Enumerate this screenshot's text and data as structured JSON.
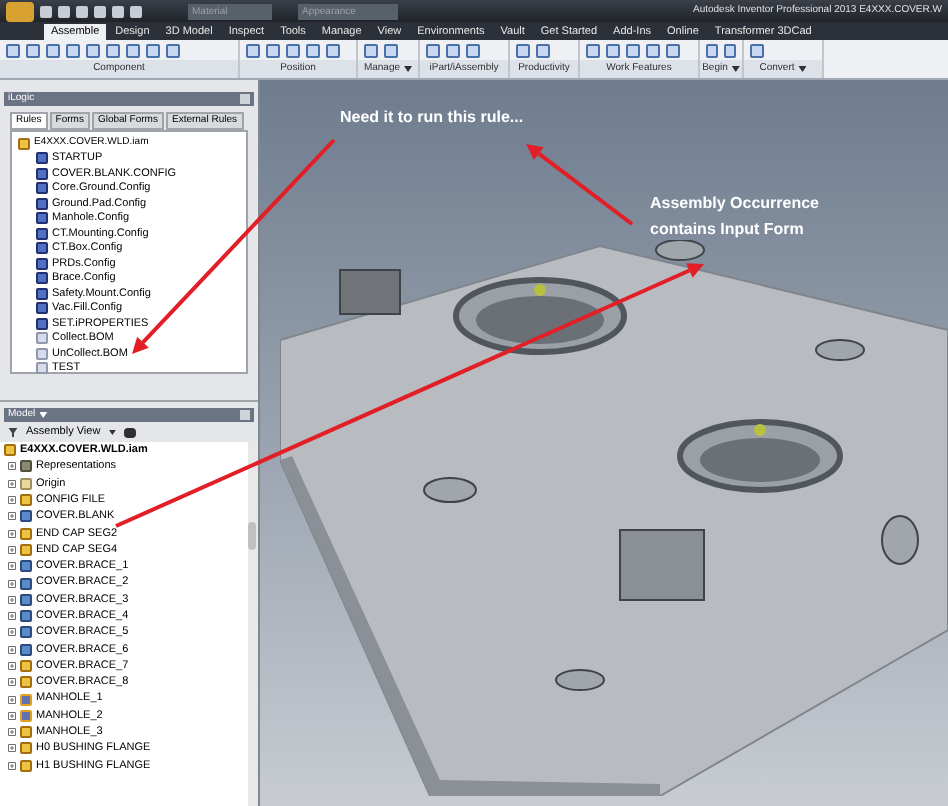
{
  "window": {
    "title": "Autodesk Inventor Professional 2013   E4XXX.COVER.W"
  },
  "quick_access": {
    "material": "Material",
    "appearance": "Appearance"
  },
  "ribbon_tabs": [
    {
      "label": "Assemble",
      "selected": true
    },
    {
      "label": "Design",
      "selected": false
    },
    {
      "label": "3D Model",
      "selected": false
    },
    {
      "label": "Inspect",
      "selected": false
    },
    {
      "label": "Tools",
      "selected": false
    },
    {
      "label": "Manage",
      "selected": false
    },
    {
      "label": "View",
      "selected": false
    },
    {
      "label": "Environments",
      "selected": false
    },
    {
      "label": "Vault",
      "selected": false
    },
    {
      "label": "Get Started",
      "selected": false
    },
    {
      "label": "Add-Ins",
      "selected": false
    },
    {
      "label": "Online",
      "selected": false
    },
    {
      "label": "Transformer 3DCad",
      "selected": false
    }
  ],
  "ribbon_panels": [
    {
      "label": "Component",
      "dropdown": false
    },
    {
      "label": "Position",
      "dropdown": false
    },
    {
      "label": "Manage",
      "dropdown": true
    },
    {
      "label": "iPart/iAssembly",
      "dropdown": false
    },
    {
      "label": "Productivity",
      "dropdown": false
    },
    {
      "label": "Work Features",
      "dropdown": false
    },
    {
      "label": "Begin",
      "dropdown": true
    },
    {
      "label": "Convert",
      "dropdown": true
    }
  ],
  "ilogic": {
    "title": "iLogic",
    "tabs": [
      {
        "label": "Rules",
        "selected": true
      },
      {
        "label": "Forms",
        "selected": false
      },
      {
        "label": "Global Forms",
        "selected": false
      },
      {
        "label": "External Rules",
        "selected": false
      }
    ],
    "root": "E4XXX.COVER.WLD.iam",
    "rules": [
      {
        "name": "STARTUP",
        "suppressed": false
      },
      {
        "name": "COVER.BLANK.CONFIG",
        "suppressed": false
      },
      {
        "name": "Core.Ground.Config",
        "suppressed": false
      },
      {
        "name": "Ground.Pad.Config",
        "suppressed": false
      },
      {
        "name": "Manhole.Config",
        "suppressed": false
      },
      {
        "name": "CT.Mounting.Config",
        "suppressed": false
      },
      {
        "name": "CT.Box.Config",
        "suppressed": false
      },
      {
        "name": "PRDs.Config",
        "suppressed": false
      },
      {
        "name": "Brace.Config",
        "suppressed": false
      },
      {
        "name": "Safety.Mount.Config",
        "suppressed": false
      },
      {
        "name": "Vac.Fill.Config",
        "suppressed": false
      },
      {
        "name": "SET.iPROPERTIES",
        "suppressed": false
      },
      {
        "name": "Collect.BOM",
        "suppressed": true
      },
      {
        "name": "UnCollect.BOM",
        "suppressed": true
      },
      {
        "name": "TEST",
        "suppressed": true
      }
    ]
  },
  "model": {
    "title": "Model",
    "view": "Assembly View",
    "root": "E4XXX.COVER.WLD.iam",
    "items": [
      {
        "name": "Representations",
        "kind": "representations"
      },
      {
        "name": "Origin",
        "kind": "origin"
      },
      {
        "name": "CONFIG FILE",
        "kind": "assembly"
      },
      {
        "name": "COVER.BLANK",
        "kind": "part"
      },
      {
        "name": "END CAP SEG2",
        "kind": "assembly"
      },
      {
        "name": "END CAP SEG4",
        "kind": "assembly"
      },
      {
        "name": "COVER.BRACE_1",
        "kind": "part"
      },
      {
        "name": "COVER.BRACE_2",
        "kind": "part"
      },
      {
        "name": "COVER.BRACE_3",
        "kind": "part"
      },
      {
        "name": "COVER.BRACE_4",
        "kind": "part"
      },
      {
        "name": "COVER.BRACE_5",
        "kind": "part"
      },
      {
        "name": "COVER.BRACE_6",
        "kind": "part"
      },
      {
        "name": "COVER.BRACE_7",
        "kind": "assembly"
      },
      {
        "name": "COVER.BRACE_8",
        "kind": "assembly"
      },
      {
        "name": "MANHOLE_1",
        "kind": "weldment"
      },
      {
        "name": "MANHOLE_2",
        "kind": "weldment"
      },
      {
        "name": "MANHOLE_3",
        "kind": "assembly"
      },
      {
        "name": "H0 BUSHING FLANGE",
        "kind": "assembly"
      },
      {
        "name": "H1 BUSHING FLANGE",
        "kind": "assembly"
      }
    ]
  },
  "annotations": [
    {
      "text": "Need it to run this rule..."
    },
    {
      "text": "Assembly Occurrence contains Input Form"
    }
  ]
}
